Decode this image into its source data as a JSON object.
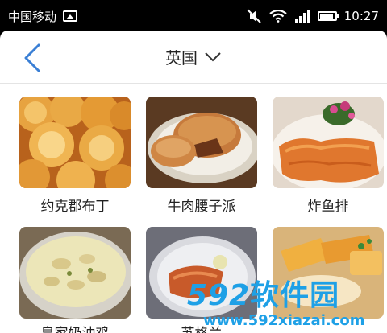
{
  "statusbar": {
    "carrier": "中国移动",
    "time": "10:27",
    "icons": [
      "gallery-icon",
      "mute-icon",
      "wifi-icon",
      "signal-icon",
      "battery-icon"
    ]
  },
  "navbar": {
    "title": "英国",
    "back_icon": "chevron-left-icon",
    "dropdown_icon": "chevron-down-icon",
    "accent": "#3a7fd5"
  },
  "dishes": [
    {
      "name": "约克郡布丁"
    },
    {
      "name": "牛肉腰子派"
    },
    {
      "name": "炸鱼排"
    },
    {
      "name": "皇家奶油鸡"
    },
    {
      "name": "苏格兰"
    },
    {
      "name": ""
    }
  ],
  "watermark": {
    "logo_num": "592",
    "logo_cn": "软件园",
    "url": "www.592xiazai.com"
  }
}
